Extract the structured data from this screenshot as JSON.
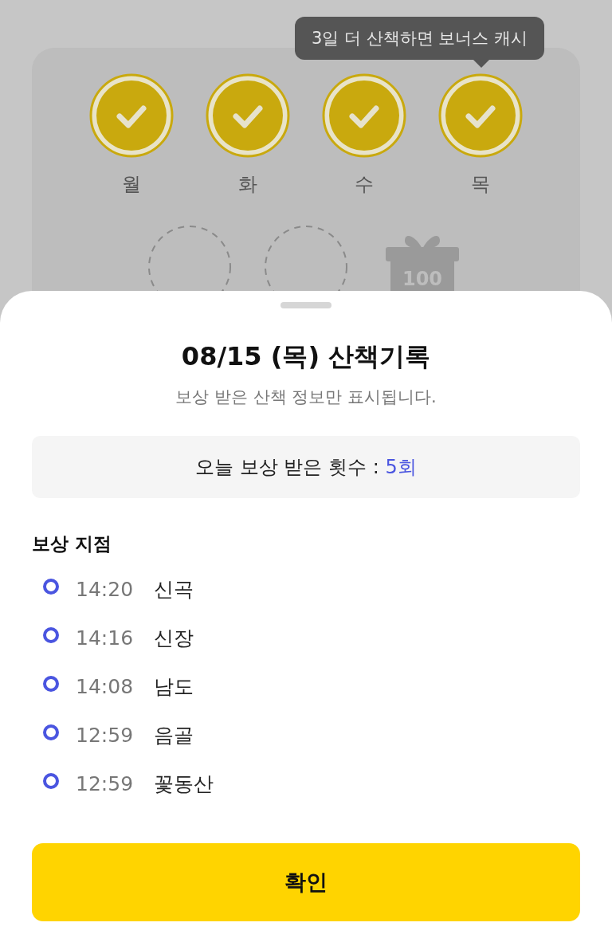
{
  "tooltip": {
    "text": "3일 더 산책하면 보너스 캐시"
  },
  "streak": [
    {
      "label": "월",
      "checked": true
    },
    {
      "label": "화",
      "checked": true
    },
    {
      "label": "수",
      "checked": true
    },
    {
      "label": "목",
      "checked": true
    },
    {
      "checked": false
    },
    {
      "checked": false
    }
  ],
  "bonus": {
    "amount": "100"
  },
  "sheet": {
    "title": "08/15 (목) 산책기록",
    "subtitle": "보상 받은 산책 정보만 표시됩니다.",
    "count_label": "오늘 보상 받은 횟수 : ",
    "count_value": "5회",
    "section_title": "보상 지점",
    "points": [
      {
        "time": "14:20",
        "place": "신곡"
      },
      {
        "time": "14:16",
        "place": "신장"
      },
      {
        "time": "14:08",
        "place": "남도"
      },
      {
        "time": "12:59",
        "place": "음골"
      },
      {
        "time": "12:59",
        "place": "꽃동산"
      }
    ],
    "confirm_button": "확인"
  }
}
